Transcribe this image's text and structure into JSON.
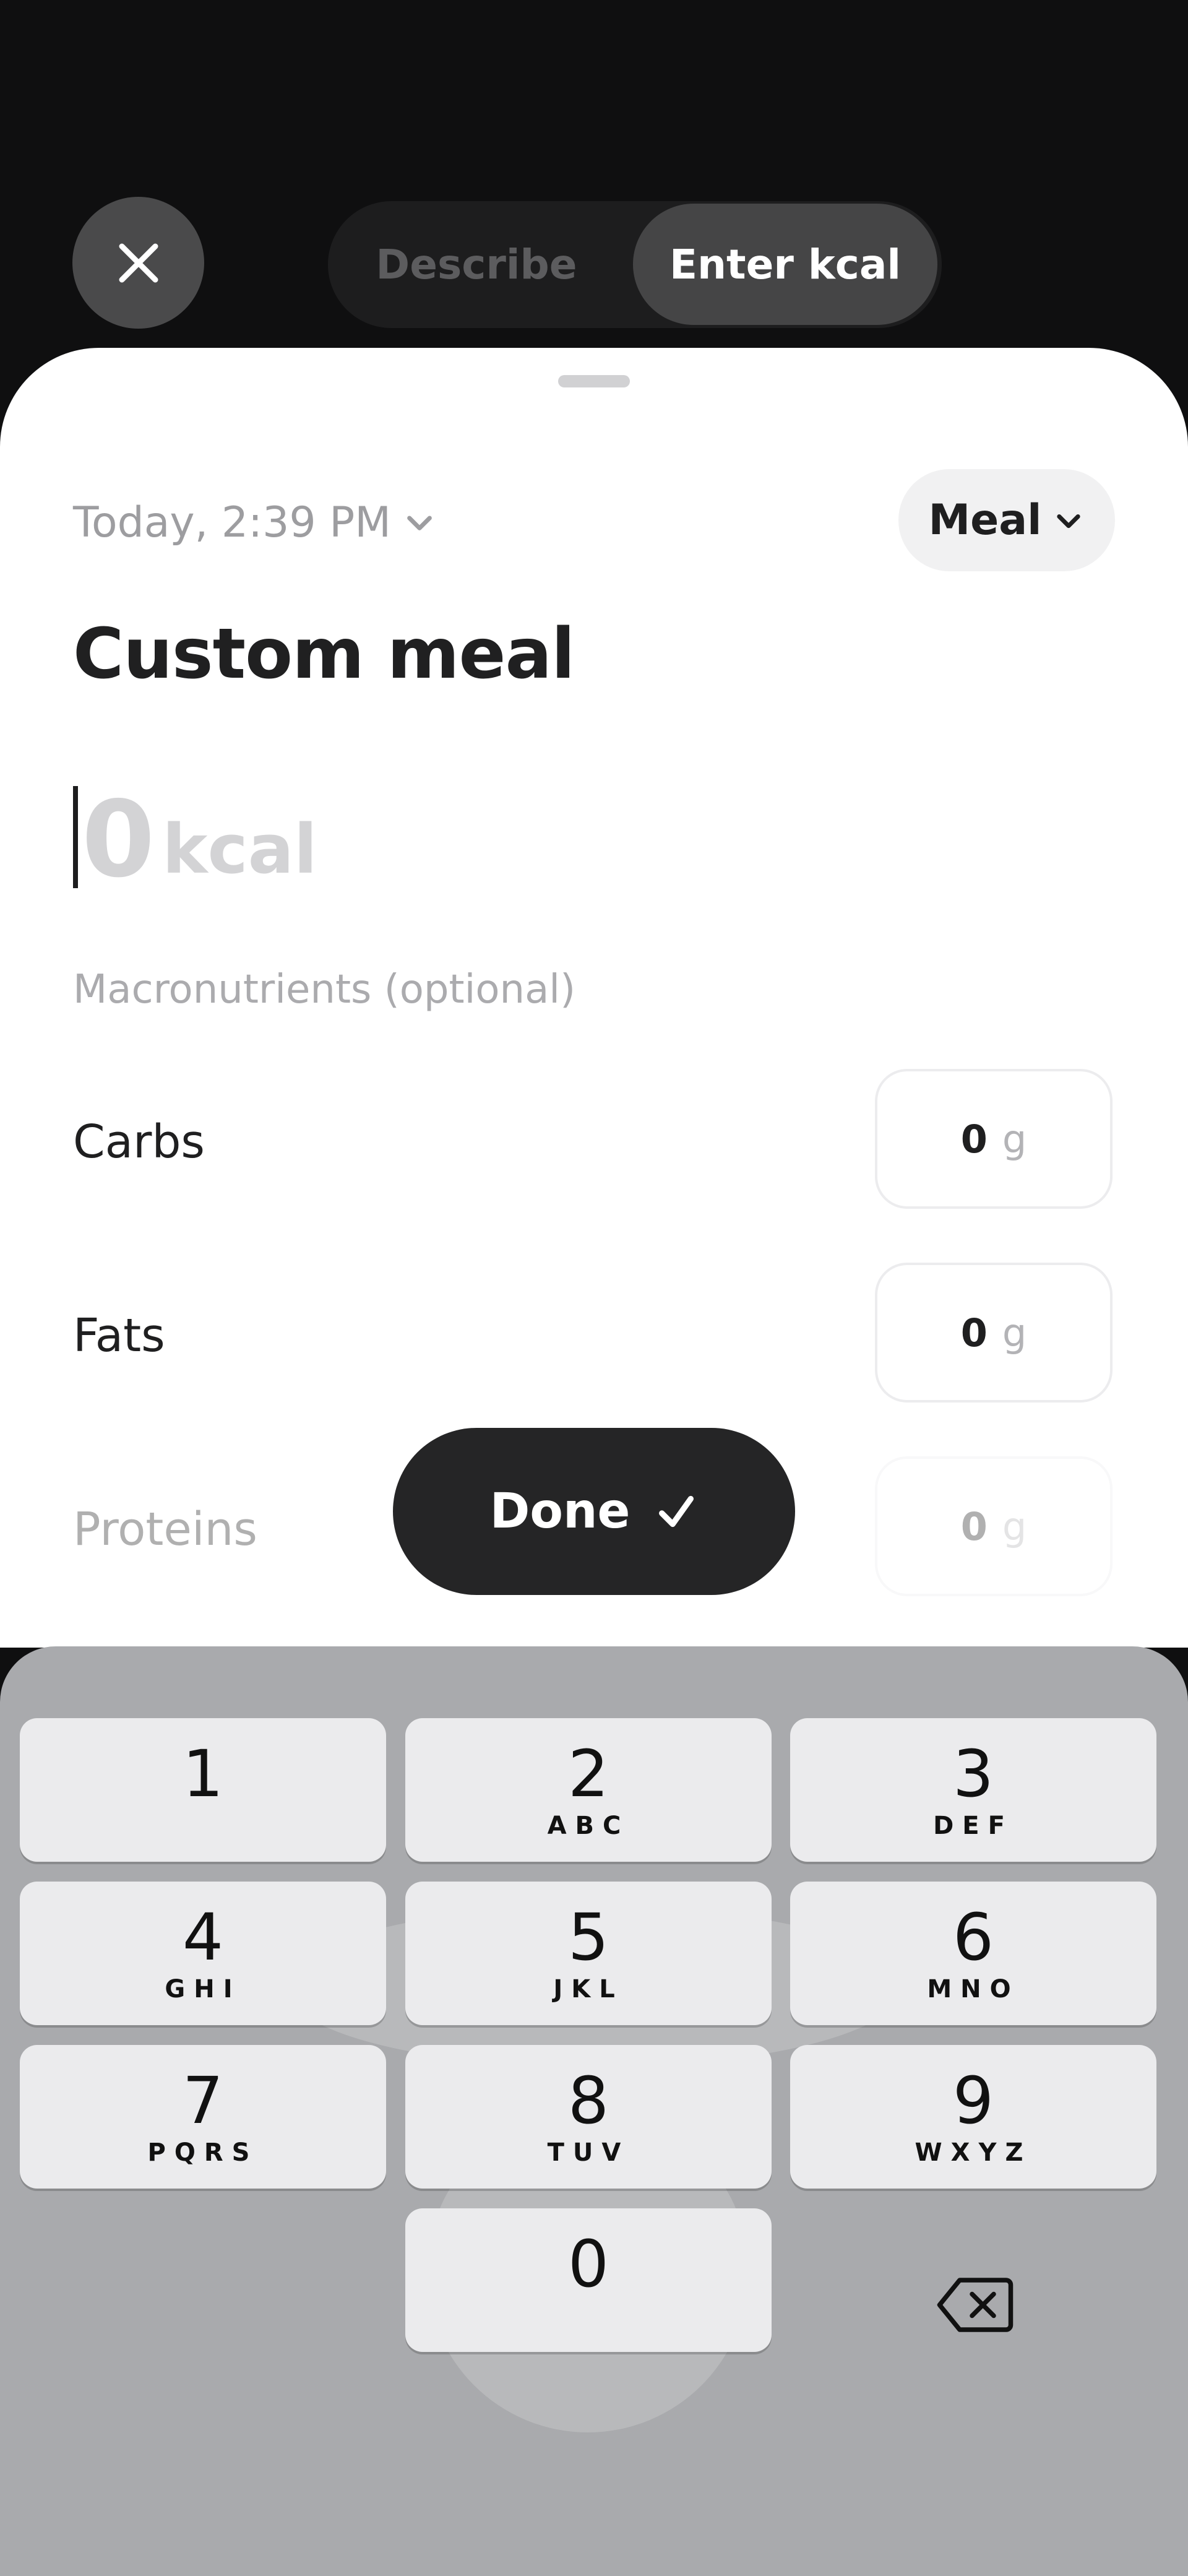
{
  "header": {
    "tabs": [
      {
        "label": "Describe",
        "selected": false
      },
      {
        "label": "Enter kcal",
        "selected": true
      }
    ],
    "close_icon": "close-icon"
  },
  "sheet": {
    "datetime": "Today, 2:39 PM",
    "meal_type": "Meal",
    "title": "Custom meal",
    "kcal_value": "0",
    "kcal_unit": "kcal",
    "macros_heading": "Macronutrients (optional)",
    "macros": [
      {
        "label": "Carbs",
        "value": "0",
        "unit": "g"
      },
      {
        "label": "Fats",
        "value": "0",
        "unit": "g"
      },
      {
        "label": "Proteins",
        "value": "0",
        "unit": "g"
      }
    ],
    "done_label": "Done"
  },
  "keyboard": {
    "keys": [
      {
        "digit": "1",
        "letters": ""
      },
      {
        "digit": "2",
        "letters": "ABC"
      },
      {
        "digit": "3",
        "letters": "DEF"
      },
      {
        "digit": "4",
        "letters": "GHI"
      },
      {
        "digit": "5",
        "letters": "JKL"
      },
      {
        "digit": "6",
        "letters": "MNO"
      },
      {
        "digit": "7",
        "letters": "PQRS"
      },
      {
        "digit": "8",
        "letters": "TUV"
      },
      {
        "digit": "9",
        "letters": "WXYZ"
      },
      {
        "digit": "0",
        "letters": ""
      }
    ],
    "backspace_icon": "backspace-icon"
  }
}
